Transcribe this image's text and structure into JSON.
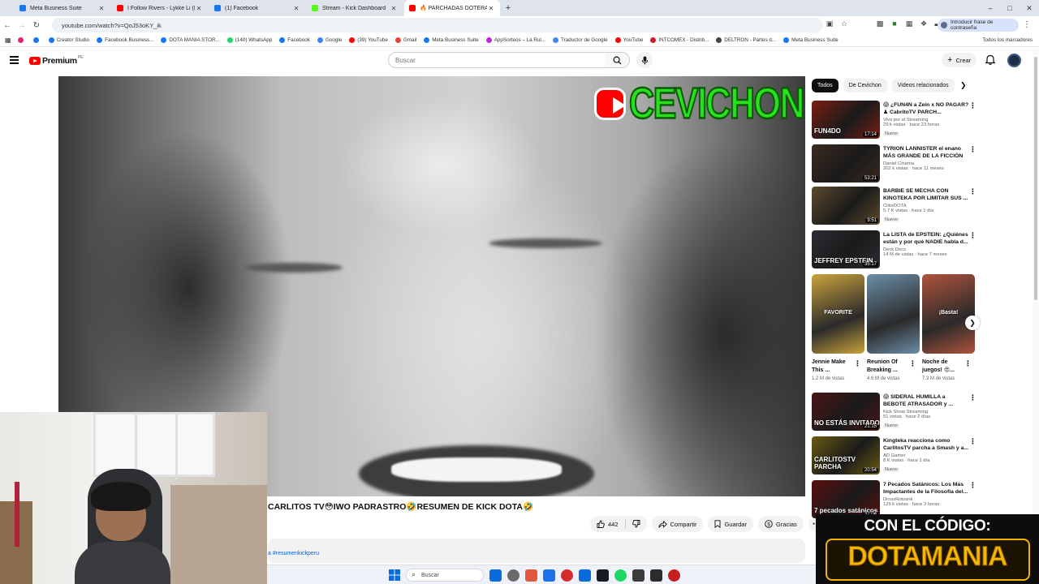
{
  "browser": {
    "tabs": [
      {
        "title": "Meta Business Suite",
        "color": "#1877f2",
        "active": false
      },
      {
        "title": "I Follow Rivers - Lykke Li (La Vie",
        "color": "#ff0000",
        "active": false
      },
      {
        "title": "(1) Facebook",
        "color": "#1877f2",
        "active": false
      },
      {
        "title": "Stream - Kick Dashboard",
        "color": "#53fc18",
        "active": false
      },
      {
        "title": "🔥 PARCHADAS DOTERAS 🔥",
        "color": "#ff0000",
        "active": true
      }
    ],
    "new_tab": "+",
    "window_controls": [
      "–",
      "□",
      "✕"
    ],
    "url": "youtube.com/watch?v=QoJ53oKY_ik",
    "password_pill": "Introducir frase de contraseña",
    "bookmarks": [
      {
        "label": "",
        "color": "#d62976"
      },
      {
        "label": "",
        "color": "#1877f2"
      },
      {
        "label": "Creator Studio",
        "color": "#1877f2"
      },
      {
        "label": "Facebook Business...",
        "color": "#1877f2"
      },
      {
        "label": "DOTA MANIA STOR...",
        "color": "#1877f2"
      },
      {
        "label": "(140) WhatsApp",
        "color": "#25d366"
      },
      {
        "label": "Facebook",
        "color": "#1877f2"
      },
      {
        "label": "Google",
        "color": "#4285f4"
      },
      {
        "label": "(39) YouTube",
        "color": "#ff0000"
      },
      {
        "label": "Gmail",
        "color": "#ea4335"
      },
      {
        "label": "Meta Business Suite",
        "color": "#1877f2"
      },
      {
        "label": "AppSorteos – La Rul...",
        "color": "#c026d3"
      },
      {
        "label": "Traductor de Google",
        "color": "#4285f4"
      },
      {
        "label": "YouTube",
        "color": "#ff0000"
      },
      {
        "label": "INTCOMEX - Distrib...",
        "color": "#d11a2a"
      },
      {
        "label": "DELTRON - Partes d...",
        "color": "#444444"
      },
      {
        "label": "Meta Business Suite",
        "color": "#1877f2"
      }
    ],
    "bookmarks_right": "Todos los marcadores"
  },
  "youtube": {
    "logo_text": "Premium",
    "logo_cc": "PE",
    "search_placeholder": "Buscar",
    "create_label": "Crear",
    "banner_text": "CEVICHON",
    "video_title": "CARLITOS TV😳IWO PADRASTRO🤣RESUMEN DE KICK DOTA🤣",
    "likes": "442",
    "share_label": "Compartir",
    "save_label": "Guardar",
    "thanks_label": "Gracias",
    "hashtag": "#resumenkickperu",
    "hashtag_prefix": "a"
  },
  "sidebar": {
    "chips": [
      "Todos",
      "De Cevichon",
      "Videos relacionados"
    ],
    "recs": [
      {
        "title": "😱 ¿FUN4N a Zein x NO PAGAR? ♟ CabritoTV PARCH...",
        "channel": "Vivo por el Streaming",
        "meta": "29 k vistas · hace 23 horas",
        "badge": "Nuevo",
        "duration": "17:14",
        "thumb_text": "FUN4DO",
        "thumb_color": "#7a1e12"
      },
      {
        "title": "TYRION LANNISTER el enano MÁS GRANDE DE LA FICCIÓN",
        "channel": "Daniel Cinema",
        "meta": "202 k vistas · hace 11 meses",
        "badge": "",
        "duration": "53:21",
        "thumb_text": "",
        "thumb_color": "#3b2a1f"
      },
      {
        "title": "BARBIE SE MECHA CON KINGTEKA POR LIMITAR SUS ...",
        "channel": "ClibsDOTA",
        "meta": "5.7 K vistas · hace 1 día",
        "badge": "Nuevo",
        "duration": "9:51",
        "thumb_text": "",
        "thumb_color": "#5e4a2e"
      },
      {
        "title": "La LISTA de EPSTEIN: ¿Quiénes están y por qué NADIE habla d...",
        "channel": "Deck Docs",
        "meta": "14 M de vistas · hace 7 meses",
        "badge": "",
        "duration": "35:17",
        "thumb_text": "JEFFREY EPSTEIN",
        "thumb_color": "#2a2d33"
      },
      {
        "title": "😱 SIDERAL HUMILLA a BEBOTE ATRASADOR y ...",
        "channel": "Kick Show Streaming",
        "meta": "51 vistas · hace 2 días",
        "badge": "Nuevo",
        "duration": "21:15",
        "thumb_text": "NO ESTÁS INVITADO",
        "thumb_color": "#4a1616"
      },
      {
        "title": "Kingteka reacciona como CarlitosTV parcha a Smash y a...",
        "channel": "AD Gamer",
        "meta": "8 K vistas · hace 1 día",
        "badge": "Nuevo",
        "duration": "20:54",
        "thumb_text": "CARLITOSTV PARCHA",
        "thumb_color": "#6a5b12"
      },
      {
        "title": "7 Pecados Satánicos: Los Más Impactantes de la Filosofía del...",
        "channel": "DrossRotzank",
        "meta": "129 k vistas · hace 3 horas",
        "badge": "",
        "duration": "32:04",
        "thumb_text": "7 pecados satánicos",
        "thumb_color": "#5a0f10"
      }
    ],
    "shorts": [
      {
        "title": "Jennie Make This ...",
        "views": "1.2 M de vistas",
        "thumb_text": "FAVORITE",
        "thumb_color": "#caa33c"
      },
      {
        "title": "Reunion Of Breaking ...",
        "views": "4.6 M de vistas",
        "thumb_text": "",
        "thumb_color": "#6b8fa8"
      },
      {
        "title": "Noche de juegos! 😍...",
        "views": "7.3 M de vistas",
        "thumb_text": "¡Basta!",
        "thumb_color": "#b0533c"
      }
    ]
  },
  "taskbar": {
    "search_label": "Buscar",
    "icons": [
      "#0a6cdc",
      "#6b6b6b",
      "#e2583e",
      "#1a73e8",
      "#d72b2b",
      "#0a6cdc",
      "#171a21",
      "#1ed760",
      "#3b3b3b",
      "#2c2c2c",
      "#c41e1e"
    ]
  },
  "promo": {
    "line1": "CON EL CÓDIGO:",
    "line2": "DOTAMANIA"
  }
}
